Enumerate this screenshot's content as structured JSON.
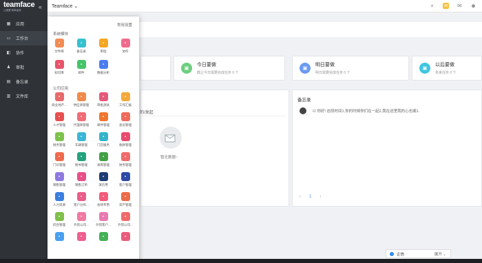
{
  "sidebar": {
    "logo": "teamface",
    "logo_sub": "让重要·简单高效",
    "collapse_icon": "«",
    "items": [
      {
        "label": "应用",
        "icon": "apps-icon"
      },
      {
        "label": "工作台",
        "icon": "monitor-icon"
      },
      {
        "label": "协作",
        "icon": "collab-icon"
      },
      {
        "label": "审批",
        "icon": "approval-icon"
      },
      {
        "label": "备忘录",
        "icon": "memo-icon"
      },
      {
        "label": "文件库",
        "icon": "folder-icon"
      }
    ]
  },
  "topbar": {
    "company": "Teamface ⌄",
    "icons": [
      "add-icon",
      "notification-icon",
      "mail-icon",
      "user-icon"
    ]
  },
  "cards": [
    {
      "title": "今日要做",
      "sub": "截止今日需要完成任务 0 个",
      "color": "#6ccf7f"
    },
    {
      "title": "明日要做",
      "sub": "明日需要完成任务 0 个",
      "color": "#6b9bf2"
    },
    {
      "title": "以后要做",
      "sub": "未来任务 0 个",
      "color": "#3ec6e0"
    }
  ],
  "left_panel": {
    "tab": "的/发起",
    "empty_text": "暂无数据~"
  },
  "memo": {
    "title": "备忘录",
    "entry": "☑ 你好! 这段时间1,你的时候你们在一起2,我在这里我的心也痛1."
  },
  "pager": {
    "prev": "‹",
    "current": "1",
    "next": "›"
  },
  "popup": {
    "settings": "常用设置",
    "system_title": "系统模块",
    "company_title": "公司应用",
    "system_modules": [
      {
        "label": "文件库",
        "color": "#f28b54"
      },
      {
        "label": "备忘录",
        "color": "#36c1cf"
      },
      {
        "label": "审批",
        "color": "#f5a623"
      },
      {
        "label": "协作",
        "color": "#f06b8b"
      },
      {
        "label": "知识库",
        "color": "#e6556b"
      },
      {
        "label": "邮件",
        "color": "#45c46b"
      },
      {
        "label": "数据分析",
        "color": "#4a7ef0"
      }
    ],
    "company_modules": [
      {
        "label": "商业地产...",
        "color": "#e96a6a"
      },
      {
        "label": "供应商管理",
        "color": "#f08a4b"
      },
      {
        "label": "审批测试",
        "color": "#e45b7b"
      },
      {
        "label": "工作汇报",
        "color": "#f3a93a"
      },
      {
        "label": "人才管理",
        "color": "#e8504f"
      },
      {
        "label": "代理商管理",
        "color": "#f06d77"
      },
      {
        "label": "邮件管理",
        "color": "#f0772f"
      },
      {
        "label": "会员管理",
        "color": "#ef6b5b"
      },
      {
        "label": "财务管理",
        "color": "#7dc24b"
      },
      {
        "label": "车辆管理",
        "color": "#3bb6d6"
      },
      {
        "label": "门店服务",
        "color": "#35b4c9"
      },
      {
        "label": "收款管理",
        "color": "#e94c6c"
      },
      {
        "label": "门诊管理",
        "color": "#f06a4d"
      },
      {
        "label": "图书管理",
        "color": "#23a37c"
      },
      {
        "label": "采购管理",
        "color": "#43a047"
      },
      {
        "label": "财务管理",
        "color": "#f06b6b"
      },
      {
        "label": "销售管理",
        "color": "#8e7ae0"
      },
      {
        "label": "销售订单",
        "color": "#e74f86"
      },
      {
        "label": "演示用",
        "color": "#1f3b73"
      },
      {
        "label": "客户管理",
        "color": "#2d4aa6"
      },
      {
        "label": "人力资源",
        "color": "#3a7fe0"
      },
      {
        "label": "客户分布...",
        "color": "#ea5d8a"
      },
      {
        "label": "会场专用",
        "color": "#f35b7b"
      },
      {
        "label": "资产管理",
        "color": "#ec6b4a"
      },
      {
        "label": "综合管理",
        "color": "#7fbf4a"
      },
      {
        "label": "外贸公司...",
        "color": "#f07aa0"
      },
      {
        "label": "外贸客户...",
        "color": "#e87ab0"
      },
      {
        "label": "外贸公司...",
        "color": "#f06a6a"
      },
      {
        "label": "",
        "color": "#4aa0f0"
      },
      {
        "label": "",
        "color": "#ef5f8f"
      },
      {
        "label": "",
        "color": "#45b058"
      },
      {
        "label": "",
        "color": "#e95d7b"
      }
    ]
  },
  "chat": {
    "label": "企信",
    "right": "展开 ⌄"
  }
}
